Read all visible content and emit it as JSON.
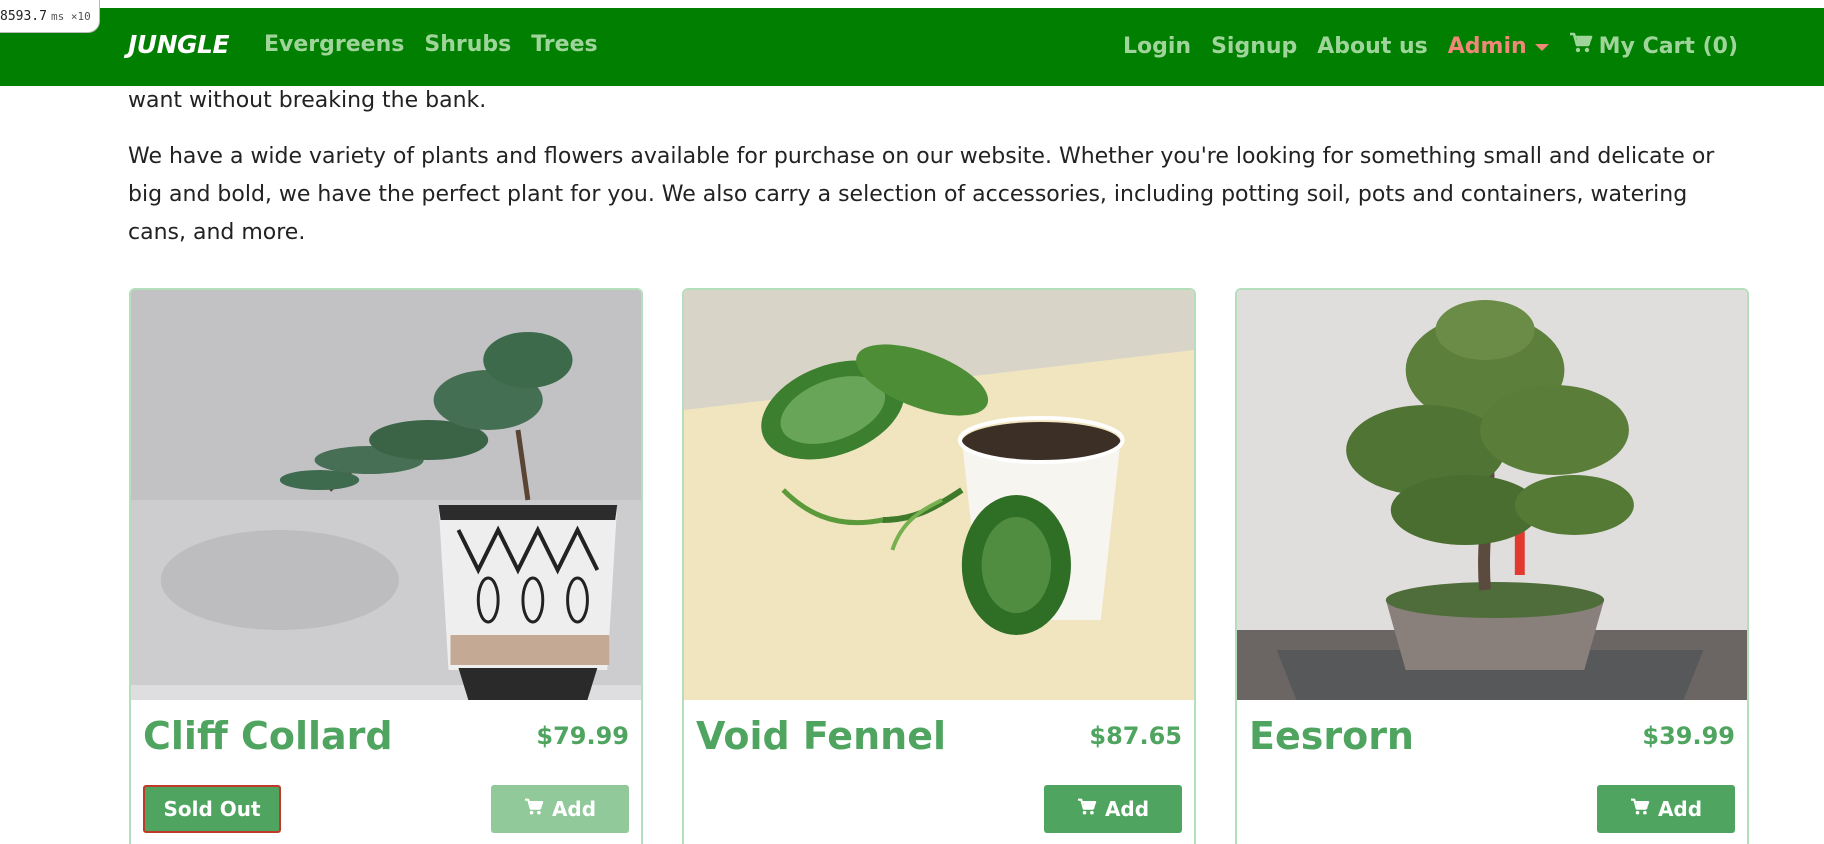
{
  "perf": {
    "value": "8593.7",
    "unit": "ms ×10"
  },
  "nav": {
    "brand": "JUNGLE",
    "left_links": [
      "Evergreens",
      "Shrubs",
      "Trees"
    ],
    "login": "Login",
    "signup": "Signup",
    "about": "About us",
    "admin": "Admin",
    "cart": "My Cart (0)",
    "cart_icon": "cart-icon",
    "caret_icon": "caret-down-icon"
  },
  "intro": {
    "line_fragment": "want without breaking the bank.",
    "paragraph": "We have a wide variety of plants and flowers available for purchase on our website. Whether you're looking for something small and delicate or big and bold, we have the perfect plant for you. We also carry a selection of accessories, including potting soil, pots and containers, watering cans, and more."
  },
  "products": [
    {
      "name": "Cliff Collard",
      "price": "$79.99",
      "sold_out_label": "Sold Out",
      "add_label": "Add",
      "sold_out": true
    },
    {
      "name": "Void Fennel",
      "price": "$87.65",
      "add_label": "Add",
      "sold_out": false
    },
    {
      "name": "Eesrorn",
      "price": "$39.99",
      "add_label": "Add",
      "sold_out": false
    }
  ],
  "colors": {
    "navbar": "#007f00",
    "nav_link": "#9fd59a",
    "admin_link": "#f08877",
    "accent_green": "#4fa55f",
    "sold_out_border": "#c0392b"
  }
}
